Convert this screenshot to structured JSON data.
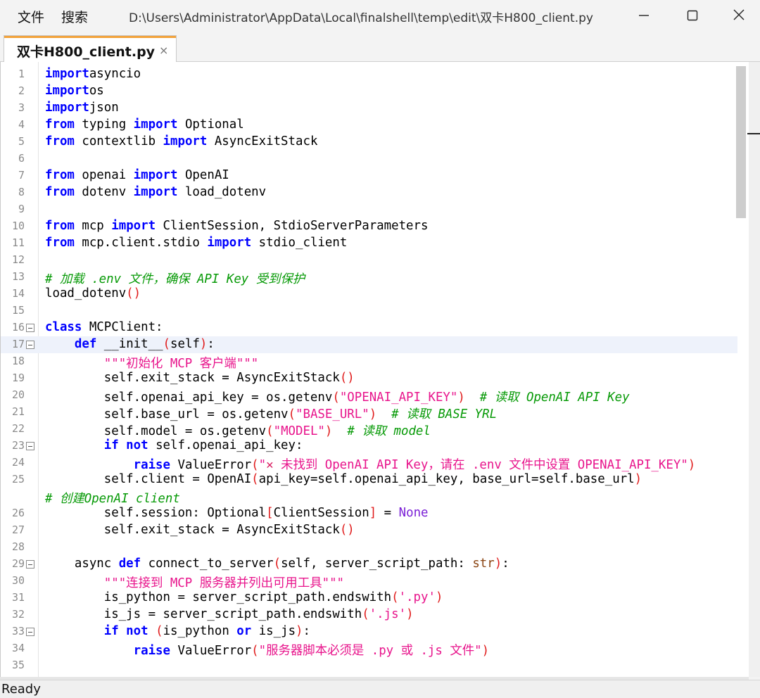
{
  "window": {
    "menu": [
      "文件",
      "搜索"
    ],
    "title_path": "D:\\Users\\Administrator\\AppData\\Local\\finalshell\\temp\\edit\\双卡H800_client.py"
  },
  "tab": {
    "label": "双卡H800_client.py",
    "close": "×"
  },
  "status": "Ready",
  "colors": {
    "keyword": "#0000ff",
    "string": "#e8158c",
    "comment": "#079a07",
    "paren": "#e01b1b",
    "tab_accent": "#f2a23a"
  },
  "current_line": 17,
  "lines": [
    {
      "n": "1",
      "fold": false,
      "tokens": [
        [
          "kw",
          "import"
        ],
        [
          "",
          "asyncio"
        ]
      ]
    },
    {
      "n": "2",
      "fold": false,
      "tokens": [
        [
          "kw",
          "import"
        ],
        [
          "",
          "os"
        ]
      ]
    },
    {
      "n": "3",
      "fold": false,
      "tokens": [
        [
          "kw",
          "import"
        ],
        [
          "",
          "json"
        ]
      ]
    },
    {
      "n": "4",
      "fold": false,
      "tokens": [
        [
          "kw",
          "from"
        ],
        [
          "",
          " typing "
        ],
        [
          "kw",
          "import"
        ],
        [
          "",
          " Optional"
        ]
      ]
    },
    {
      "n": "5",
      "fold": false,
      "tokens": [
        [
          "kw",
          "from"
        ],
        [
          "",
          " contextlib "
        ],
        [
          "kw",
          "import"
        ],
        [
          "",
          " AsyncExitStack"
        ]
      ]
    },
    {
      "n": "6",
      "fold": false,
      "tokens": []
    },
    {
      "n": "7",
      "fold": false,
      "tokens": [
        [
          "kw",
          "from"
        ],
        [
          "",
          " openai "
        ],
        [
          "kw",
          "import"
        ],
        [
          "",
          " OpenAI"
        ]
      ]
    },
    {
      "n": "8",
      "fold": false,
      "tokens": [
        [
          "kw",
          "from"
        ],
        [
          "",
          " dotenv "
        ],
        [
          "kw",
          "import"
        ],
        [
          "",
          " load_dotenv"
        ]
      ]
    },
    {
      "n": "9",
      "fold": false,
      "tokens": []
    },
    {
      "n": "10",
      "fold": false,
      "tokens": [
        [
          "kw",
          "from"
        ],
        [
          "",
          " mcp "
        ],
        [
          "kw",
          "import"
        ],
        [
          "",
          " ClientSession, StdioServerParameters"
        ]
      ]
    },
    {
      "n": "11",
      "fold": false,
      "tokens": [
        [
          "kw",
          "from"
        ],
        [
          "",
          " mcp.client.stdio "
        ],
        [
          "kw",
          "import"
        ],
        [
          "",
          " stdio_client"
        ]
      ]
    },
    {
      "n": "12",
      "fold": false,
      "tokens": []
    },
    {
      "n": "13",
      "fold": false,
      "tokens": [
        [
          "cmt",
          "# 加载 .env 文件，确保 API Key 受到保护"
        ]
      ]
    },
    {
      "n": "14",
      "fold": false,
      "tokens": [
        [
          "",
          "load_dotenv"
        ],
        [
          "par",
          "()"
        ]
      ]
    },
    {
      "n": "15",
      "fold": false,
      "tokens": []
    },
    {
      "n": "16",
      "fold": true,
      "tokens": [
        [
          "kw",
          "class"
        ],
        [
          "",
          " MCPClient:"
        ]
      ]
    },
    {
      "n": "17",
      "fold": true,
      "tokens": [
        [
          "",
          "    "
        ],
        [
          "kw",
          "def"
        ],
        [
          "",
          " __init__"
        ],
        [
          "par",
          "("
        ],
        [
          "",
          "self"
        ],
        [
          "par",
          ")"
        ],
        [
          "",
          ":"
        ]
      ]
    },
    {
      "n": "18",
      "fold": false,
      "tokens": [
        [
          "",
          "        "
        ],
        [
          "str",
          "\"\"\"初始化 MCP 客户端\"\"\""
        ]
      ]
    },
    {
      "n": "19",
      "fold": false,
      "tokens": [
        [
          "",
          "        self.exit_stack = AsyncExitStack"
        ],
        [
          "par",
          "()"
        ]
      ]
    },
    {
      "n": "20",
      "fold": false,
      "tokens": [
        [
          "",
          "        self.openai_api_key = os.getenv"
        ],
        [
          "par",
          "("
        ],
        [
          "str",
          "\"OPENAI_API_KEY\""
        ],
        [
          "par",
          ")"
        ],
        [
          "",
          "  "
        ],
        [
          "cmt",
          "# 读取 OpenAI API Key"
        ]
      ]
    },
    {
      "n": "21",
      "fold": false,
      "tokens": [
        [
          "",
          "        self.base_url = os.getenv"
        ],
        [
          "par",
          "("
        ],
        [
          "str",
          "\"BASE_URL\""
        ],
        [
          "par",
          ")"
        ],
        [
          "",
          "  "
        ],
        [
          "cmt",
          "# 读取 BASE YRL"
        ]
      ]
    },
    {
      "n": "22",
      "fold": false,
      "tokens": [
        [
          "",
          "        self.model = os.getenv"
        ],
        [
          "par",
          "("
        ],
        [
          "str",
          "\"MODEL\""
        ],
        [
          "par",
          ")"
        ],
        [
          "",
          "  "
        ],
        [
          "cmt",
          "# 读取 model"
        ]
      ]
    },
    {
      "n": "23",
      "fold": true,
      "tokens": [
        [
          "",
          "        "
        ],
        [
          "kw",
          "if not"
        ],
        [
          "",
          " self.openai_api_key:"
        ]
      ]
    },
    {
      "n": "24",
      "fold": false,
      "tokens": [
        [
          "",
          "            "
        ],
        [
          "kw",
          "raise"
        ],
        [
          "",
          " ValueError"
        ],
        [
          "par",
          "("
        ],
        [
          "str",
          "\""
        ],
        [
          "xmark",
          "✕"
        ],
        [
          "str",
          " 未找到 OpenAI API Key，请在 .env 文件中设置 OPENAI_API_KEY\""
        ],
        [
          "par",
          ")"
        ]
      ]
    },
    {
      "n": "25",
      "fold": false,
      "tokens": [
        [
          "",
          "        self.client = OpenAI"
        ],
        [
          "par",
          "("
        ],
        [
          "",
          "api_key=self.openai_api_key, base_url=self.base_url"
        ],
        [
          "par",
          ")"
        ]
      ]
    },
    {
      "n": "",
      "fold": false,
      "tokens": [
        [
          "cmt",
          "# 创建OpenAI client"
        ]
      ]
    },
    {
      "n": "26",
      "fold": false,
      "tokens": [
        [
          "",
          "        self.session: Optional"
        ],
        [
          "par",
          "["
        ],
        [
          "",
          "ClientSession"
        ],
        [
          "par",
          "]"
        ],
        [
          "",
          " = "
        ],
        [
          "none",
          "None"
        ]
      ]
    },
    {
      "n": "27",
      "fold": false,
      "tokens": [
        [
          "",
          "        self.exit_stack = AsyncExitStack"
        ],
        [
          "par",
          "()"
        ]
      ]
    },
    {
      "n": "28",
      "fold": false,
      "tokens": []
    },
    {
      "n": "29",
      "fold": true,
      "tokens": [
        [
          "",
          "    async "
        ],
        [
          "kw",
          "def"
        ],
        [
          "",
          " connect_to_server"
        ],
        [
          "par",
          "("
        ],
        [
          "",
          "self, server_script_path: "
        ],
        [
          "typ",
          "str"
        ],
        [
          "par",
          ")"
        ],
        [
          "",
          ":"
        ]
      ]
    },
    {
      "n": "30",
      "fold": false,
      "tokens": [
        [
          "",
          "        "
        ],
        [
          "str",
          "\"\"\"连接到 MCP 服务器并列出可用工具\"\"\""
        ]
      ]
    },
    {
      "n": "31",
      "fold": false,
      "tokens": [
        [
          "",
          "        is_python = server_script_path.endswith"
        ],
        [
          "par",
          "("
        ],
        [
          "str",
          "'.py'"
        ],
        [
          "par",
          ")"
        ]
      ]
    },
    {
      "n": "32",
      "fold": false,
      "tokens": [
        [
          "",
          "        is_js = server_script_path.endswith"
        ],
        [
          "par",
          "("
        ],
        [
          "str",
          "'.js'"
        ],
        [
          "par",
          ")"
        ]
      ]
    },
    {
      "n": "33",
      "fold": true,
      "tokens": [
        [
          "",
          "        "
        ],
        [
          "kw",
          "if not"
        ],
        [
          "",
          " "
        ],
        [
          "par",
          "("
        ],
        [
          "",
          "is_python "
        ],
        [
          "kw",
          "or"
        ],
        [
          "",
          " is_js"
        ],
        [
          "par",
          ")"
        ],
        [
          "",
          ":"
        ]
      ]
    },
    {
      "n": "34",
      "fold": false,
      "tokens": [
        [
          "",
          "            "
        ],
        [
          "kw",
          "raise"
        ],
        [
          "",
          " ValueError"
        ],
        [
          "par",
          "("
        ],
        [
          "str",
          "\"服务器脚本必须是 .py 或 .js 文件\""
        ],
        [
          "par",
          ")"
        ]
      ]
    },
    {
      "n": "35",
      "fold": false,
      "tokens": []
    }
  ]
}
